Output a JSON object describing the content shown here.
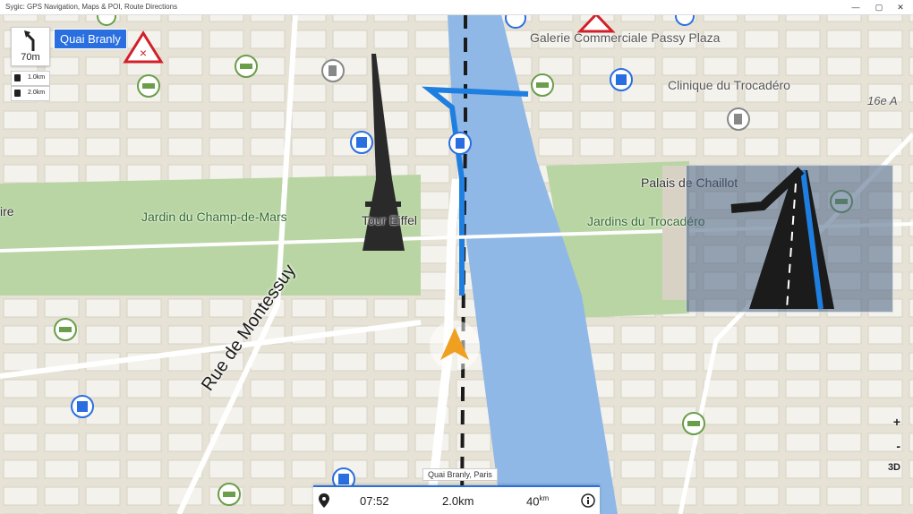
{
  "window": {
    "title": "Sygic: GPS Navigation, Maps & POI, Route Directions",
    "controls": [
      "—",
      "▢",
      "✕"
    ]
  },
  "navigation": {
    "turn_distance": "70m",
    "next_street": "Quai Branly",
    "info": [
      {
        "icon": "fuel-icon",
        "value": "1.0km"
      },
      {
        "icon": "parking-icon",
        "value": "2.0km"
      }
    ]
  },
  "map_labels": {
    "street": "Rue de Montessuy",
    "parks": [
      "Jardin du Champ-de-Mars",
      "Jardins du Trocadéro"
    ],
    "landmarks": [
      "Tour Eiffel",
      "Palais de Chaillot"
    ],
    "pois": [
      "Galerie Commerciale Passy Plaza",
      "Clinique du Trocadéro"
    ],
    "district": "16e A",
    "edge_label": "ire"
  },
  "controls": {
    "zoom_in": "+",
    "zoom_out": "-",
    "view_mode": "3D"
  },
  "bottom_bar": {
    "address": "Quai Branly, Paris",
    "eta": "07:52",
    "distance": "2.0",
    "distance_unit": "km",
    "speed": "40",
    "speed_unit": "km"
  },
  "colors": {
    "route": "#1e7fe0",
    "river": "#8fb8e6",
    "park": "#b9d5a3",
    "accent": "#2a6fe0",
    "position_arrow": "#f0a020"
  }
}
